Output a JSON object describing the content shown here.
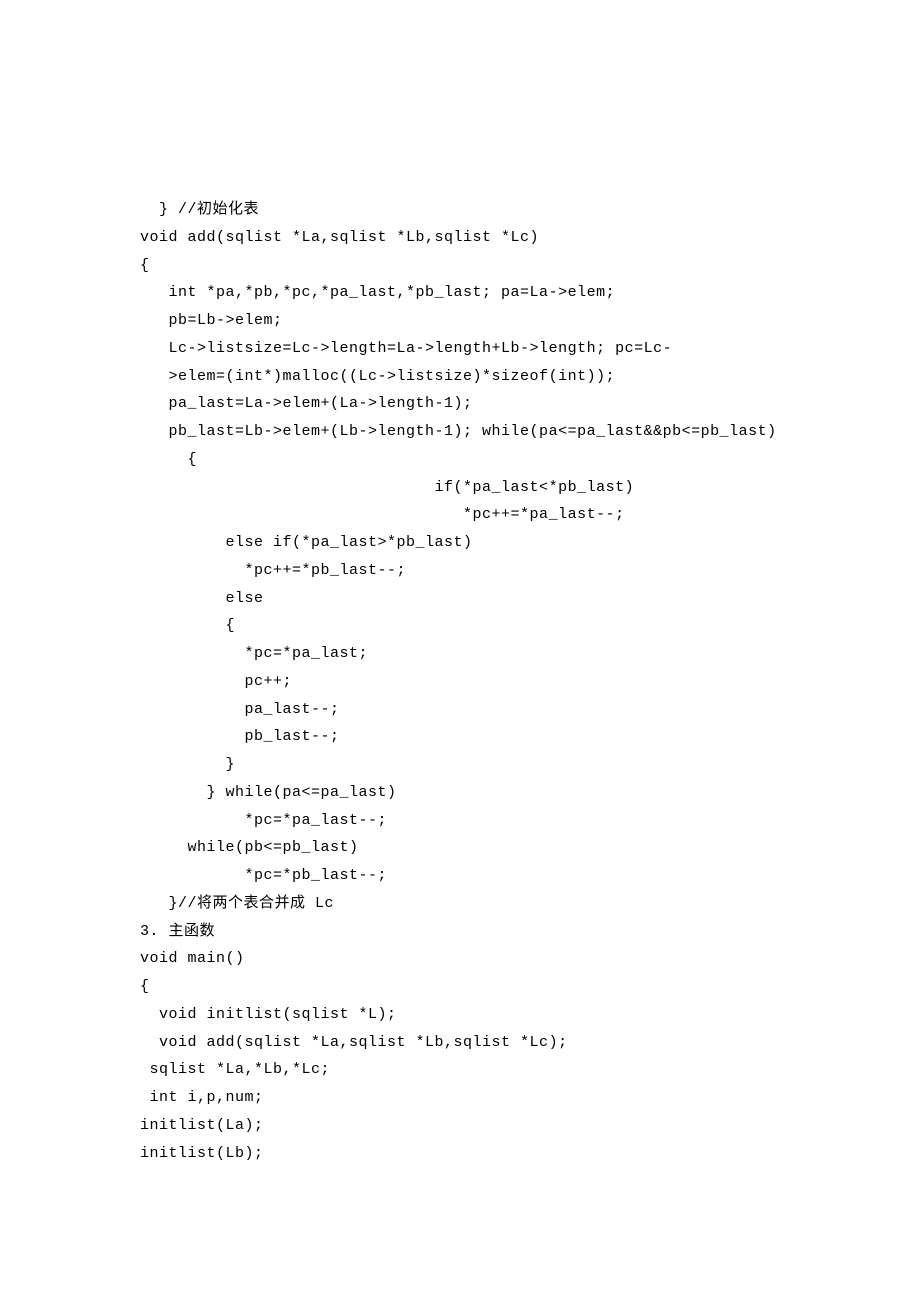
{
  "lines": [
    "  } //初始化表",
    "void add(sqlist *La,sqlist *Lb,sqlist *Lc)",
    "{",
    "   int *pa,*pb,*pc,*pa_last,*pb_last; pa=La->elem;",
    "   pb=Lb->elem;",
    "   Lc->listsize=Lc->length=La->length+Lb->length; pc=Lc-",
    "   >elem=(int*)malloc((Lc->listsize)*sizeof(int));",
    "",
    "   pa_last=La->elem+(La->length-1);",
    "   pb_last=Lb->elem+(Lb->length-1); while(pa<=pa_last&&pb<=pb_last)",
    "     {",
    "                               if(*pa_last<*pb_last)",
    "                                  *pc++=*pa_last--;",
    "         else if(*pa_last>*pb_last)",
    "           *pc++=*pb_last--;",
    "         else",
    "         {",
    "           *pc=*pa_last;",
    "           pc++;",
    "           pa_last--;",
    "           pb_last--;",
    "         }",
    "       } while(pa<=pa_last)",
    "           *pc=*pa_last--;",
    "     while(pb<=pb_last)",
    "           *pc=*pb_last--;",
    "",
    "   }//将两个表合并成 Lc",
    "",
    "3. 主函数",
    "void main()",
    "{",
    "  void initlist(sqlist *L);",
    "  void add(sqlist *La,sqlist *Lb,sqlist *Lc);",
    " sqlist *La,*Lb,*Lc;",
    " int i,p,num;",
    "",
    "initlist(La);",
    "initlist(Lb);"
  ]
}
